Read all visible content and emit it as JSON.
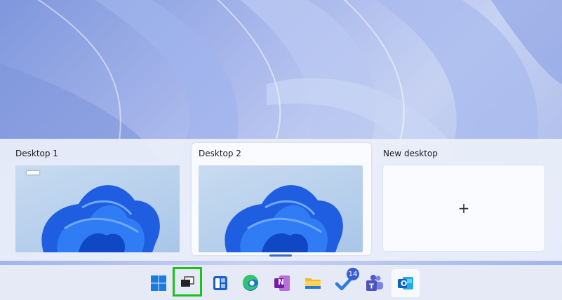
{
  "task_view": {
    "desktops": [
      {
        "label": "Desktop 1",
        "has_minimized_window": true
      },
      {
        "label": "Desktop 2",
        "active": true
      },
      {
        "label": "New desktop",
        "icon": "plus-icon",
        "glyph": "+"
      }
    ]
  },
  "taskbar": {
    "items": [
      {
        "name": "start",
        "icon": "windows-logo-icon"
      },
      {
        "name": "task-view",
        "icon": "task-view-icon",
        "highlighted": true
      },
      {
        "name": "widgets",
        "icon": "widgets-icon"
      },
      {
        "name": "edge",
        "icon": "edge-icon"
      },
      {
        "name": "onenote",
        "icon": "onenote-icon",
        "letter": "N"
      },
      {
        "name": "file-explorer",
        "icon": "folder-icon"
      },
      {
        "name": "todo",
        "icon": "todo-check-icon",
        "badge": "14"
      },
      {
        "name": "teams",
        "icon": "teams-icon"
      },
      {
        "name": "outlook",
        "icon": "outlook-icon",
        "letter": "O"
      }
    ]
  },
  "colors": {
    "highlight_box": "#18c41a",
    "accent": "#3a68c8"
  }
}
